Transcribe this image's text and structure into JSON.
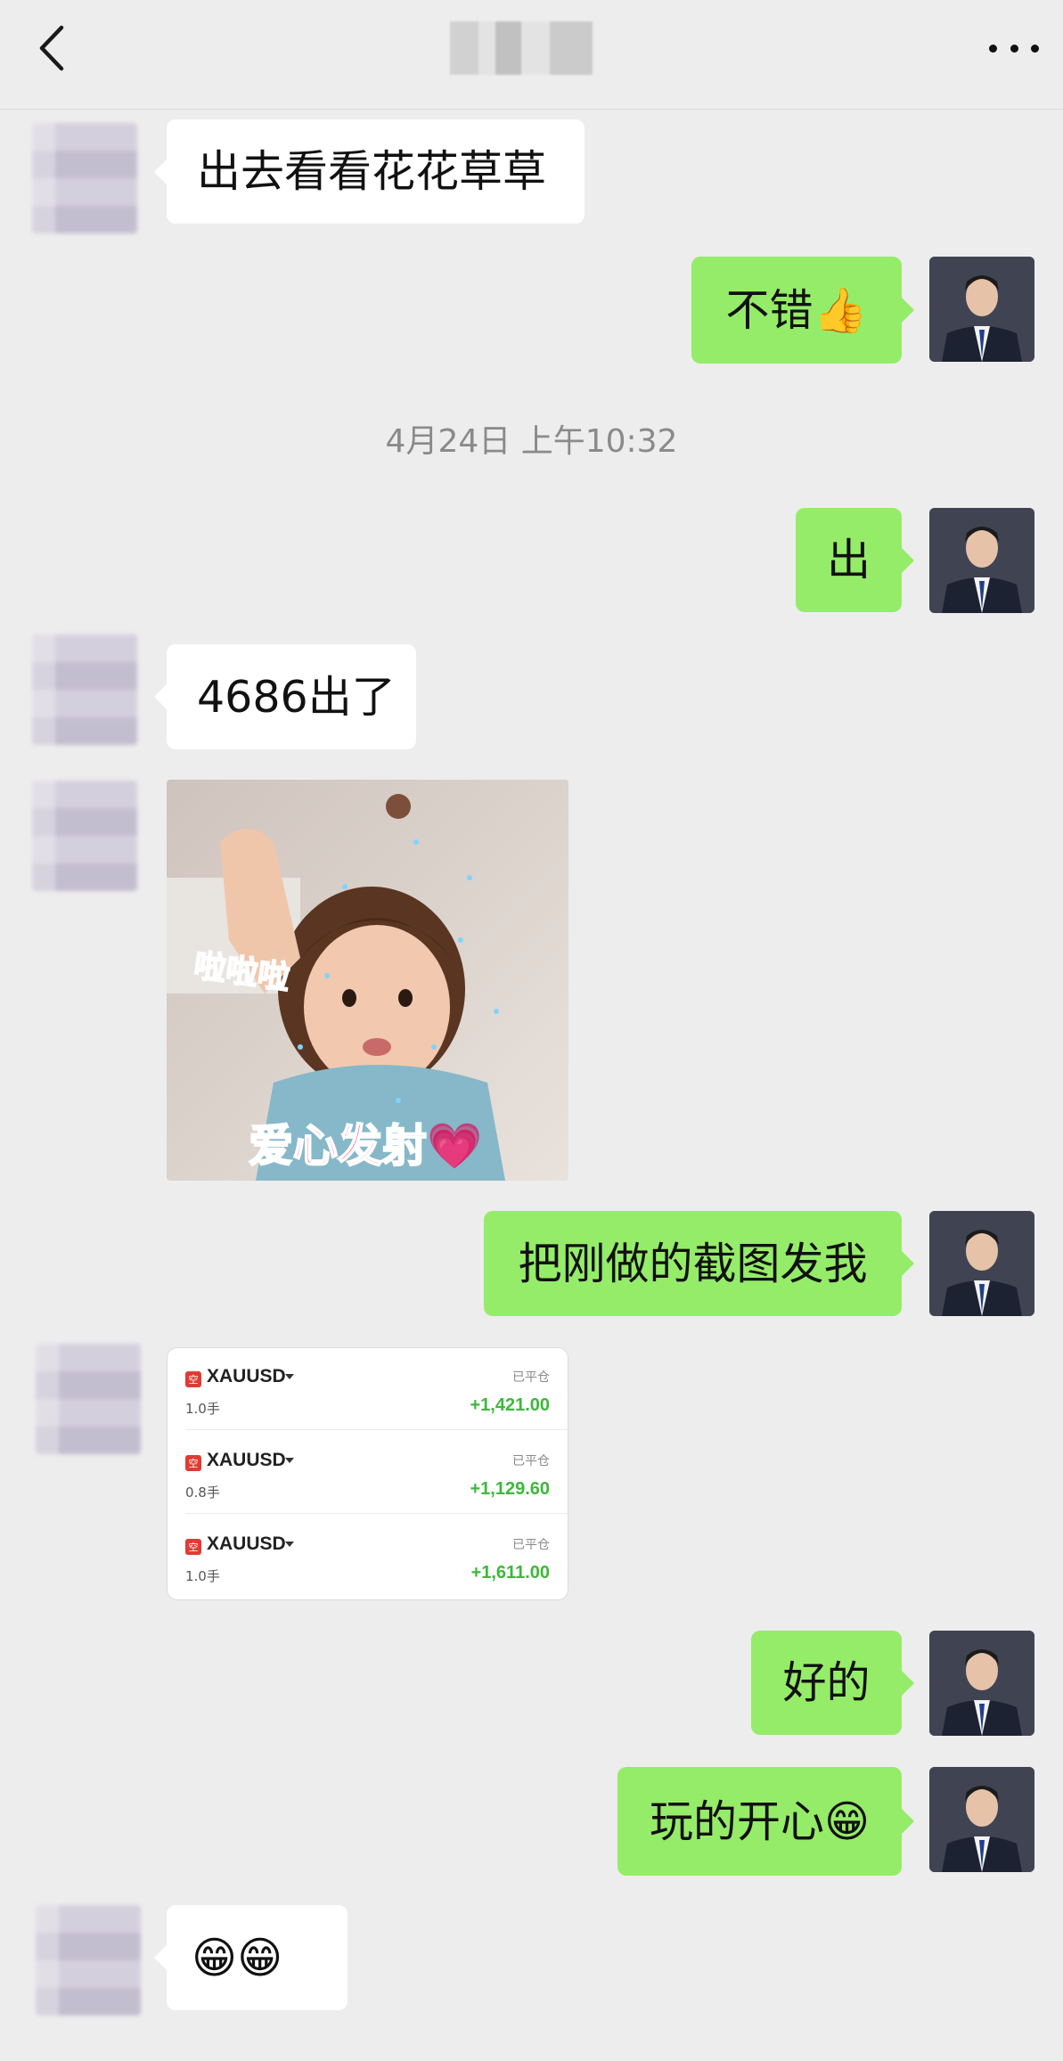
{
  "header": {
    "back_icon": "chevron-left-icon",
    "more_icon": "more-dots-icon"
  },
  "messages": {
    "m1": "出去看看花花草草",
    "m2": "不错👍",
    "timestamp": "4月24日 上午10:32",
    "m3": "出",
    "m4": "4686出了",
    "sticker_top_text": "啦啦啦",
    "sticker_bottom_text": "爱心发射💗",
    "m5": "把刚做的截图发我",
    "m6": "好的",
    "m7": "玩的开心😁",
    "m8": "😁😁"
  },
  "trades": [
    {
      "tag": "空",
      "symbol": "XAUUSD",
      "status": "已平仓",
      "lot": "1.0手",
      "pnl": "+1,421.00"
    },
    {
      "tag": "空",
      "symbol": "XAUUSD",
      "status": "已平仓",
      "lot": "0.8手",
      "pnl": "+1,129.60"
    },
    {
      "tag": "空",
      "symbol": "XAUUSD",
      "status": "已平仓",
      "lot": "1.0手",
      "pnl": "+1,611.00"
    }
  ],
  "colors": {
    "background": "#ededed",
    "my_bubble": "#95ec69",
    "other_bubble": "#ffffff",
    "profit_green": "#3db83b"
  }
}
